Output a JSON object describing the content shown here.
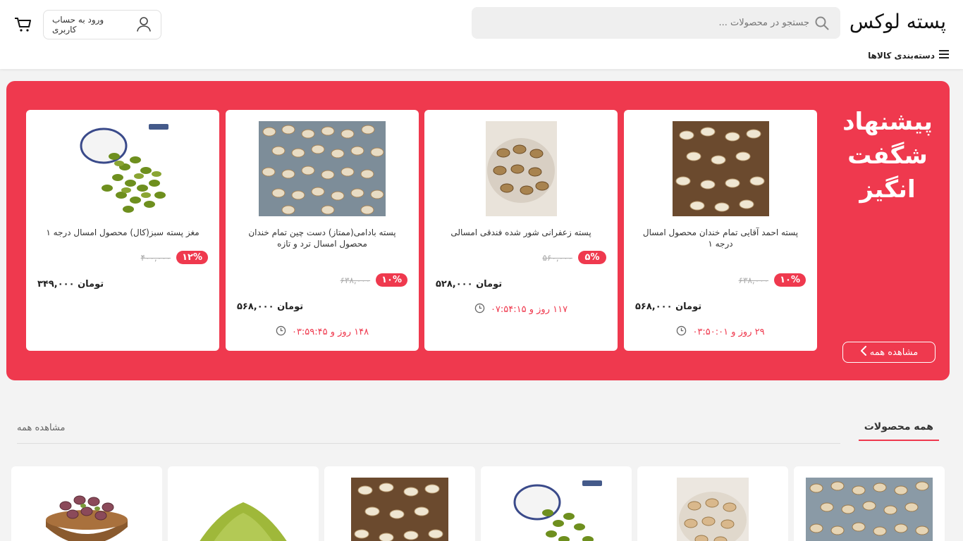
{
  "header": {
    "logo": "پسته لوکس",
    "search_placeholder": "جستجو در محصولات ...",
    "login_label": "ورود به حساب کاربری",
    "categories_label": "دسته‌بندی کالاها"
  },
  "amazing": {
    "title_line1": "پیشنهاد",
    "title_line2": "شگفت",
    "title_line3": "انگیز",
    "view_all": "مشاهده همه",
    "products": [
      {
        "title": "پسته احمد آقایی تمام خندان محصول امسال درجه ۱",
        "discount": "۱۰%",
        "old_price": "۶۳۸,۰۰۰",
        "price": "۵۶۸,۰۰۰ تومان",
        "timer": "۲۹ روز و ۰۳:۵۰:۰۱"
      },
      {
        "title": "پسته زعفرانی شور شده فندقی امسالی",
        "discount": "۵%",
        "old_price": "۵۶۰,۰۰۰",
        "price": "۵۲۸,۰۰۰ تومان",
        "timer": "۱۱۷ روز و ۰۷:۵۴:۱۵"
      },
      {
        "title": "پسته بادامی(ممتاز) دست چین تمام خندان محصول امسال ترد و تازه",
        "discount": "۱۰%",
        "old_price": "۶۳۸,۰۰۰",
        "price": "۵۶۸,۰۰۰ تومان",
        "timer": "۱۴۸ روز و ۰۳:۵۹:۴۵"
      },
      {
        "title": "مغز پسته سبز(کال) محصول امسال درجه ۱",
        "discount": "۱۲%",
        "old_price": "۴۰۰,۰۰۰",
        "price": "۳۴۹,۰۰۰ تومان",
        "timer": ""
      }
    ]
  },
  "all_products": {
    "title": "همه محصولات",
    "view_all": "مشاهده همه"
  },
  "colors": {
    "accent": "#ef394e"
  }
}
